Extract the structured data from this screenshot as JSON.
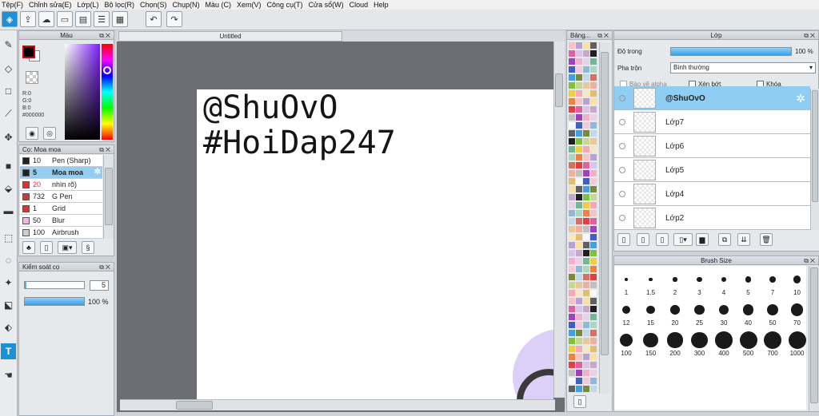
{
  "menu": [
    "Tệp(F)",
    "Chỉnh sửa(E)",
    "Lớp(L)",
    "Bộ lọc(R)",
    "Chọn(S)",
    "Chụp(N)",
    "Màu (C)",
    "Xem(V)",
    "Công cụ(T)",
    "Cửa sổ(W)",
    "Cloud",
    "Help"
  ],
  "color_panel": {
    "title": "Màu",
    "rgb": {
      "r": "R:0",
      "g": "G:0",
      "b": "B:0"
    },
    "hex": "#000000",
    "fg_color": "#000000",
    "bg_color": "#ffffff"
  },
  "brush_panel": {
    "title": "Cọ: Moa moa",
    "items": [
      {
        "size": "10",
        "name": "Pen (Sharp)",
        "color": "#222222"
      },
      {
        "size": "5",
        "name": "Moa moa",
        "color": "#222222",
        "selected": true
      },
      {
        "size": "20",
        "name": "nhìn rõ)",
        "color": "#e03030"
      },
      {
        "size": "732",
        "name": "G Pen",
        "color": "#e03030"
      },
      {
        "size": "1",
        "name": "Grid",
        "color": "#e03030"
      },
      {
        "size": "50",
        "name": "Blur",
        "color": "#ffb0e8"
      },
      {
        "size": "100",
        "name": "Airbrush",
        "color": "#cccccc"
      }
    ]
  },
  "brush_control": {
    "title": "Kiểm soát cọ",
    "size_value": "5",
    "opacity_value": "100 %",
    "opacity_fraction": 1.0
  },
  "document": {
    "tab_title": "Untitled",
    "line1": "@ShuOvO",
    "line2": "#HoiDap247"
  },
  "palette_panel": {
    "title": "Bảng..."
  },
  "layer_panel": {
    "title": "Lớp",
    "opacity_label": "Độ trong",
    "opacity_value": "100 %",
    "opacity_fraction": 1.0,
    "blend_label": "Pha trộn",
    "blend_value": "Bình thường",
    "alpha_protect": "Bảo vệ alpha",
    "clipping": "Xén bớt",
    "lock": "Khóa",
    "layers": [
      {
        "name": "@ShuOvO",
        "selected": true
      },
      {
        "name": "Lớp7"
      },
      {
        "name": "Lớp6"
      },
      {
        "name": "Lớp5"
      },
      {
        "name": "Lớp4"
      },
      {
        "name": "Lớp2"
      }
    ]
  },
  "brush_size_panel": {
    "title": "Brush Size",
    "sizes": [
      "1",
      "1.5",
      "2",
      "3",
      "4",
      "5",
      "7",
      "10",
      "12",
      "15",
      "20",
      "25",
      "30",
      "40",
      "50",
      "70",
      "100",
      "150",
      "200",
      "300",
      "400",
      "500",
      "700",
      "1000"
    ]
  },
  "icons": [
    "pointer-icon",
    "brush-icon",
    "eraser-icon",
    "select-rect-icon",
    "eyedropper-icon",
    "move-icon",
    "fill-icon",
    "bucket-icon",
    "gradient-icon",
    "lasso-icon",
    "magic-wand-icon",
    "text-icon",
    "hand-icon"
  ]
}
